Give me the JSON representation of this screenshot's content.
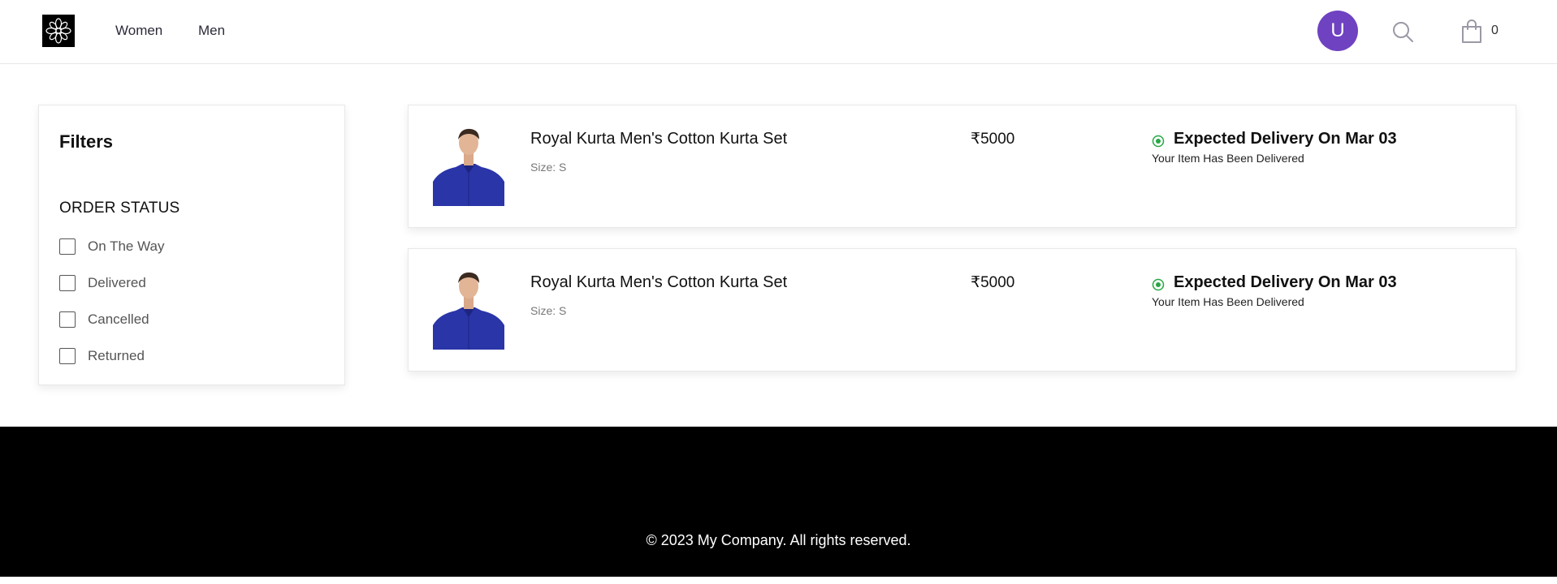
{
  "header": {
    "logo_icon": "flower-ornament-icon",
    "nav": [
      {
        "label": "Women"
      },
      {
        "label": "Men"
      }
    ],
    "avatar_initial": "U",
    "avatar_color": "#6f42c1",
    "search_icon": "search-icon",
    "cart_icon": "shopping-bag-icon",
    "cart_count": "0"
  },
  "filters": {
    "title": "Filters",
    "section_title": "ORDER STATUS",
    "options": [
      {
        "label": "On The Way",
        "checked": false
      },
      {
        "label": "Delivered",
        "checked": false
      },
      {
        "label": "Cancelled",
        "checked": false
      },
      {
        "label": "Returned",
        "checked": false
      }
    ]
  },
  "orders": [
    {
      "name": "Royal Kurta Men's Cotton Kurta Set",
      "size": "Size: S",
      "price": "₹5000",
      "status_title": "Expected Delivery On Mar 03",
      "status_sub": "Your Item Has Been Delivered",
      "status_color": "#28a745"
    },
    {
      "name": "Royal Kurta Men's Cotton Kurta Set",
      "size": "Size: S",
      "price": "₹5000",
      "status_title": "Expected Delivery On Mar 03",
      "status_sub": "Your Item Has Been Delivered",
      "status_color": "#28a745"
    }
  ],
  "footer": {
    "copyright": "© 2023 My Company. All rights reserved."
  }
}
